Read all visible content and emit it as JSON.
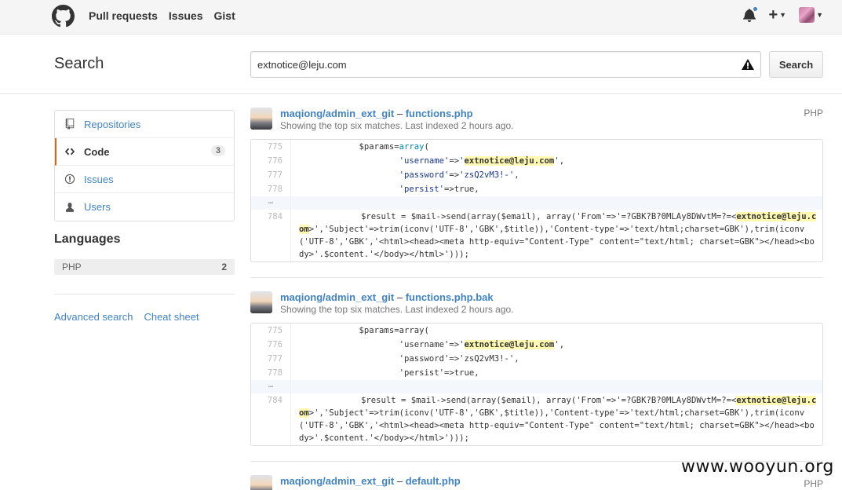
{
  "nav": {
    "items": [
      "Pull requests",
      "Issues",
      "Gist"
    ]
  },
  "search": {
    "title": "Search",
    "query": "extnotice@leju.com",
    "button": "Search"
  },
  "sidebar": {
    "menu": [
      {
        "label": "Repositories",
        "icon": "repo-icon"
      },
      {
        "label": "Code",
        "icon": "code-icon",
        "count": "3",
        "selected": true
      },
      {
        "label": "Issues",
        "icon": "issue-icon"
      },
      {
        "label": "Users",
        "icon": "person-icon"
      }
    ],
    "languages_title": "Languages",
    "languages": [
      {
        "name": "PHP",
        "count": "2"
      }
    ],
    "links": [
      "Advanced search",
      "Cheat sheet"
    ]
  },
  "results": [
    {
      "repo": "maqiong/admin_ext_git",
      "sep": "–",
      "file": "functions.php",
      "lang": "PHP",
      "subtitle": "Showing the top six matches. Last indexed 2 hours ago.",
      "lines": [
        "775",
        "776",
        "777",
        "778",
        "…",
        "784"
      ]
    },
    {
      "repo": "maqiong/admin_ext_git",
      "sep": "–",
      "file": "functions.php.bak",
      "lang": "PHP",
      "subtitle": "Showing the top six matches. Last indexed 2 hours ago.",
      "lines": [
        "775",
        "776",
        "777",
        "778",
        "…",
        "784"
      ]
    },
    {
      "repo": "maqiong/admin_ext_git",
      "sep": "–",
      "file": "default.php",
      "lang": "PHP"
    }
  ],
  "code": {
    "l775_a": "$params=",
    "l775_b": "array",
    "l775_c": "(",
    "l776_a": "'username'",
    "l776_b": "=>",
    "l776_c": "'",
    "l776_hl": "extnotice@leju.com",
    "l776_d": "'",
    "l776_e": ",",
    "l777_a": "'password'",
    "l777_b": "=>",
    "l777_c": "'zsQ2vM3!-'",
    "l777_d": ",",
    "l778_a": "'persist'",
    "l778_b": "=>true,",
    "l784_a": "$result = $mail->send(array($email), array('From'=>'=?GBK?B?0MLAy8DWvtM=?=<",
    "l784_hl": "extnotice@leju.com",
    "l784_b": ">','Subject'=>trim(iconv('UTF-8','GBK',$title)),'Content-type'=>'text/html;charset=GBK'),trim(iconv('UTF-8','GBK','<html><head><meta http-equiv=\"Content-Type\" content=\"text/html; charset=GBK\"></head><body>'.$content.'</body></html>')));"
  },
  "watermark": "www.wooyun.org"
}
